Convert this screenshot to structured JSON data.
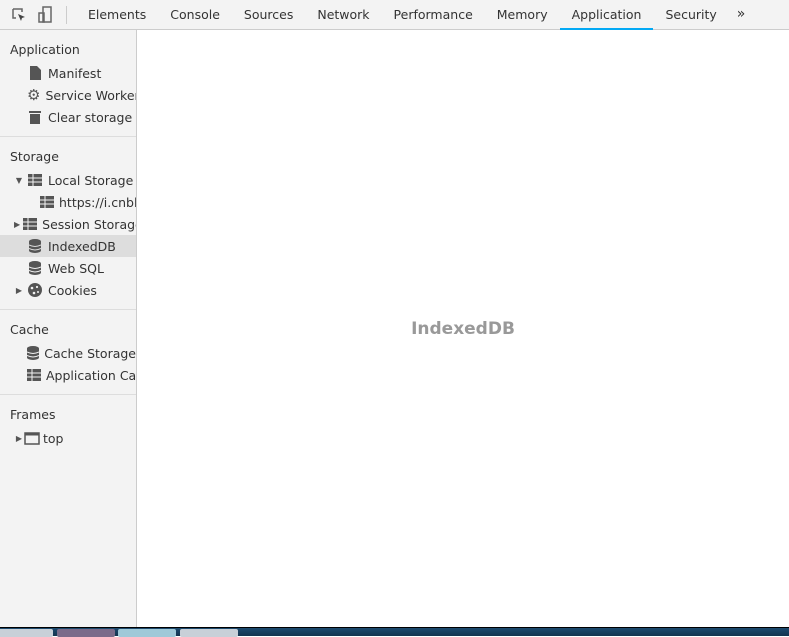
{
  "toolbar": {
    "tabs": [
      "Elements",
      "Console",
      "Sources",
      "Network",
      "Performance",
      "Memory",
      "Application",
      "Security"
    ],
    "active_tab": "Application",
    "more": "»"
  },
  "sidebar": {
    "application": {
      "title": "Application",
      "items": [
        "Manifest",
        "Service Workers",
        "Clear storage"
      ]
    },
    "storage": {
      "title": "Storage",
      "local_storage": "Local Storage",
      "local_origin": "https://i.cnblogs.com",
      "session_storage": "Session Storage",
      "indexeddb": "IndexedDB",
      "websql": "Web SQL",
      "cookies": "Cookies"
    },
    "cache": {
      "title": "Cache",
      "items": [
        "Cache Storage",
        "Application Cache"
      ]
    },
    "frames": {
      "title": "Frames",
      "top": "top"
    }
  },
  "main": {
    "placeholder": "IndexedDB"
  },
  "colors": {
    "accent": "#03a9f4"
  }
}
